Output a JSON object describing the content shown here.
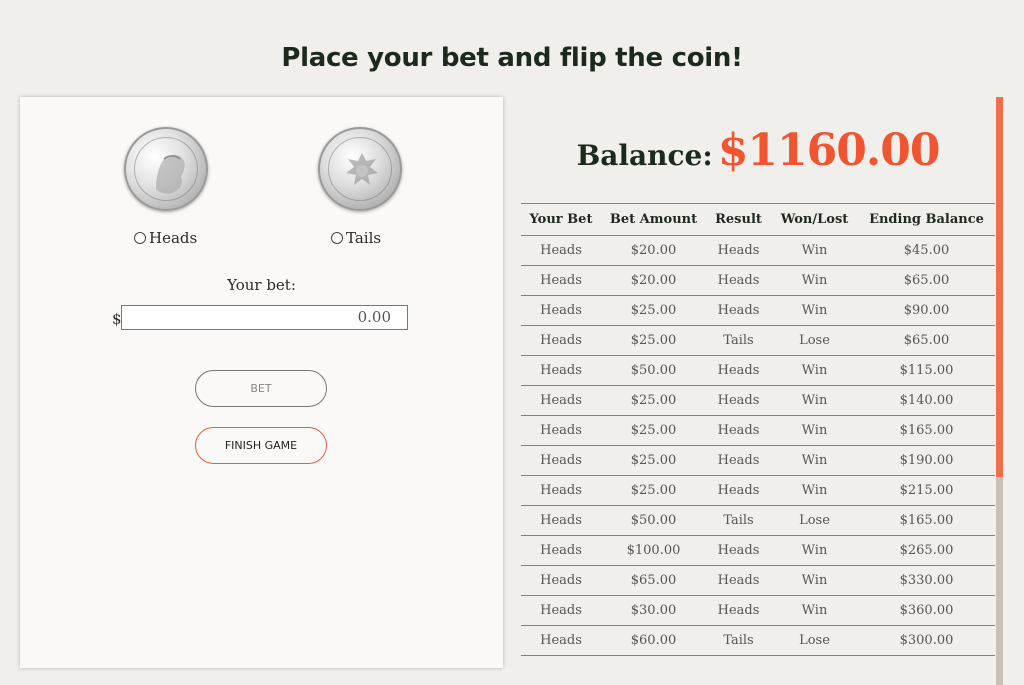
{
  "page": {
    "title": "Place your bet and flip the coin!"
  },
  "bet_form": {
    "heads_label": "Heads",
    "tails_label": "Tails",
    "selected_side": "",
    "bet_label": "Your bet:",
    "currency_symbol": "$",
    "bet_value": "0.00",
    "bet_button": "BET",
    "finish_button": "FINISH GAME"
  },
  "balance": {
    "label": "Balance:",
    "value": "$1160.00"
  },
  "history": {
    "columns": [
      "Your Bet",
      "Bet Amount",
      "Result",
      "Won/Lost",
      "Ending Balance"
    ],
    "rows": [
      [
        "Heads",
        "$20.00",
        "Heads",
        "Win",
        "$45.00"
      ],
      [
        "Heads",
        "$20.00",
        "Heads",
        "Win",
        "$65.00"
      ],
      [
        "Heads",
        "$25.00",
        "Heads",
        "Win",
        "$90.00"
      ],
      [
        "Heads",
        "$25.00",
        "Tails",
        "Lose",
        "$65.00"
      ],
      [
        "Heads",
        "$50.00",
        "Heads",
        "Win",
        "$115.00"
      ],
      [
        "Heads",
        "$25.00",
        "Heads",
        "Win",
        "$140.00"
      ],
      [
        "Heads",
        "$25.00",
        "Heads",
        "Win",
        "$165.00"
      ],
      [
        "Heads",
        "$25.00",
        "Heads",
        "Win",
        "$190.00"
      ],
      [
        "Heads",
        "$25.00",
        "Heads",
        "Win",
        "$215.00"
      ],
      [
        "Heads",
        "$50.00",
        "Tails",
        "Lose",
        "$165.00"
      ],
      [
        "Heads",
        "$100.00",
        "Heads",
        "Win",
        "$265.00"
      ],
      [
        "Heads",
        "$65.00",
        "Heads",
        "Win",
        "$330.00"
      ],
      [
        "Heads",
        "$30.00",
        "Heads",
        "Win",
        "$360.00"
      ],
      [
        "Heads",
        "$60.00",
        "Tails",
        "Lose",
        "$300.00"
      ]
    ]
  },
  "colors": {
    "accent": "#f0552f",
    "title_text": "#1b2a1a",
    "background": "#f1efec",
    "panel": "#faf9f7",
    "scrollbar_thumb": "#f26d4a",
    "scrollbar_track": "#c8c1ba"
  },
  "icons": {
    "heads_coin": "kennedy-half-dollar-heads-icon",
    "tails_coin": "kennedy-half-dollar-tails-icon"
  }
}
